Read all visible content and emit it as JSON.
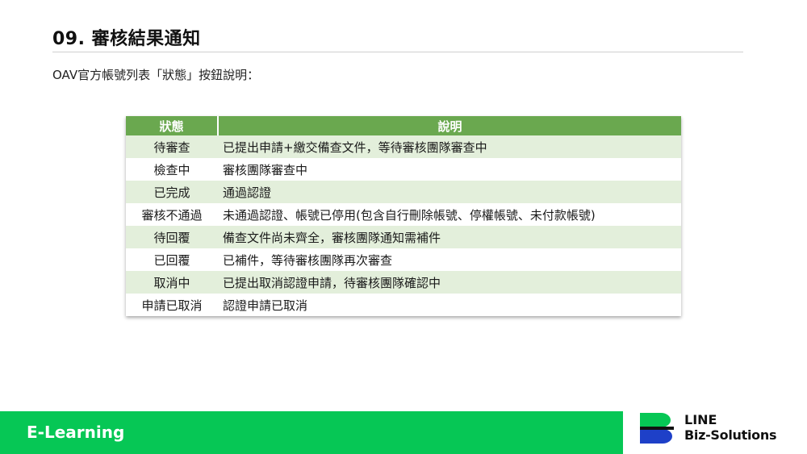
{
  "slide": {
    "title": "09. 審核結果通知",
    "subtitle": "OAV官方帳號列表「狀態」按鈕說明："
  },
  "table": {
    "headers": [
      "狀態",
      "說明"
    ],
    "rows": [
      {
        "status": "待審查",
        "description": "已提出申請+繳交備查文件，等待審核團隊審查中"
      },
      {
        "status": "檢查中",
        "description": "審核團隊審查中"
      },
      {
        "status": "已完成",
        "description": "通過認證"
      },
      {
        "status": "審核不通過",
        "description": "未通過認證、帳號已停用(包含自行刪除帳號、停權帳號、未付款帳號)"
      },
      {
        "status": "待回覆",
        "description": "備查文件尚未齊全，審核團隊通知需補件"
      },
      {
        "status": "已回覆",
        "description": "已補件，等待審核團隊再次審查"
      },
      {
        "status": "取消中",
        "description": "已提出取消認證申請，待審核團隊確認中"
      },
      {
        "status": "申請已取消",
        "description": "認證申請已取消"
      }
    ]
  },
  "footer": {
    "label": "E-Learning",
    "brand_line1": "LINE",
    "brand_line2": "Biz-Solutions"
  },
  "colors": {
    "header_green": "#6aa84f",
    "row_tint": "#e3efdb",
    "footer_green": "#06c755",
    "logo_green": "#06c755",
    "logo_blue": "#1e40c8",
    "logo_dark": "#111111"
  }
}
